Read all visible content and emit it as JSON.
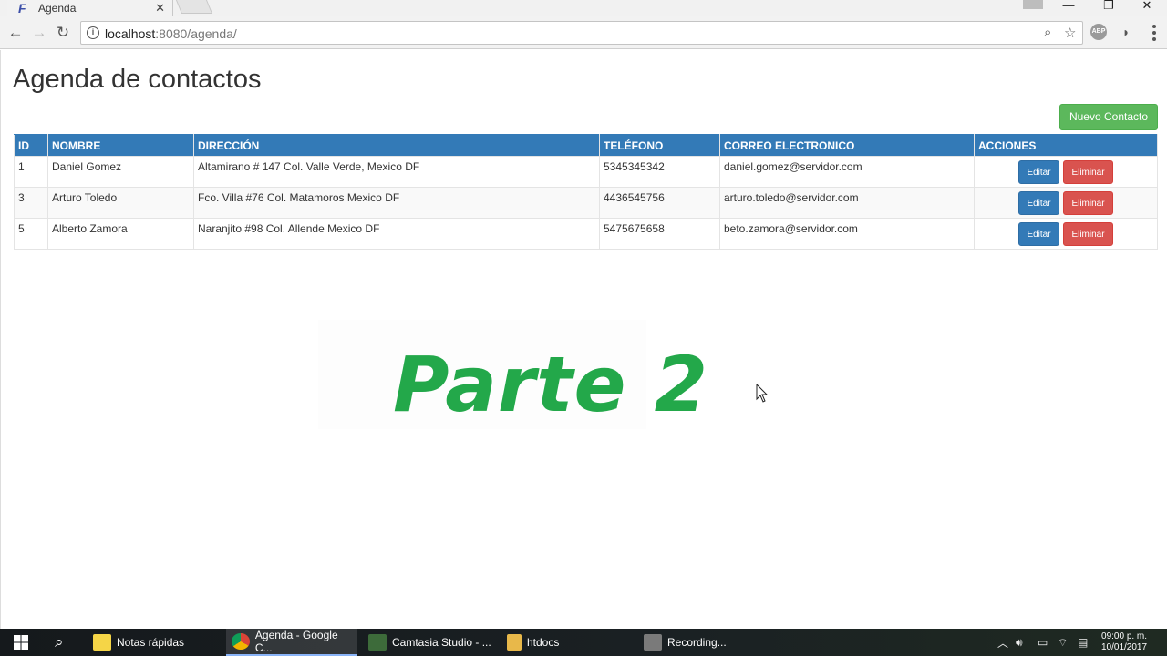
{
  "browser": {
    "tab_title": "Agenda",
    "tab_favicon": "F",
    "url_host": "localhost",
    "url_rest": ":8080/agenda/",
    "ext_abp": "ABP"
  },
  "page": {
    "title": "Agenda de contactos",
    "new_contact_label": "Nuevo Contacto",
    "overlay_text": "Parte 2"
  },
  "table": {
    "headers": [
      "ID",
      "NOMBRE",
      "DIRECCIÓN",
      "TELÉFONO",
      "CORREO ELECTRONICO",
      "ACCIONES"
    ],
    "rows": [
      {
        "id": "1",
        "nombre": "Daniel Gomez",
        "direccion": "Altamirano # 147 Col. Valle Verde, Mexico DF",
        "telefono": "5345345342",
        "correo": "daniel.gomez@servidor.com",
        "edit": "Editar",
        "delete": "Eliminar"
      },
      {
        "id": "3",
        "nombre": "Arturo Toledo",
        "direccion": "Fco. Villa #76 Col. Matamoros Mexico DF",
        "telefono": "4436545756",
        "correo": "arturo.toledo@servidor.com",
        "edit": "Editar",
        "delete": "Eliminar"
      },
      {
        "id": "5",
        "nombre": "Alberto Zamora",
        "direccion": "Naranjito #98 Col. Allende Mexico DF",
        "telefono": "5475675658",
        "correo": "beto.zamora@servidor.com",
        "edit": "Editar",
        "delete": "Eliminar"
      }
    ]
  },
  "taskbar": {
    "items": [
      {
        "label": "Notas rápidas"
      },
      {
        "label": "Agenda - Google C..."
      },
      {
        "label": "Camtasia Studio - ..."
      },
      {
        "label": "htdocs"
      },
      {
        "label": "Recording..."
      }
    ],
    "time": "09:00 p. m.",
    "date": "10/01/2017"
  },
  "colors": {
    "primary": "#337ab7",
    "success": "#5cb85c",
    "danger": "#d9534f",
    "overlay_green": "#23a84a"
  }
}
